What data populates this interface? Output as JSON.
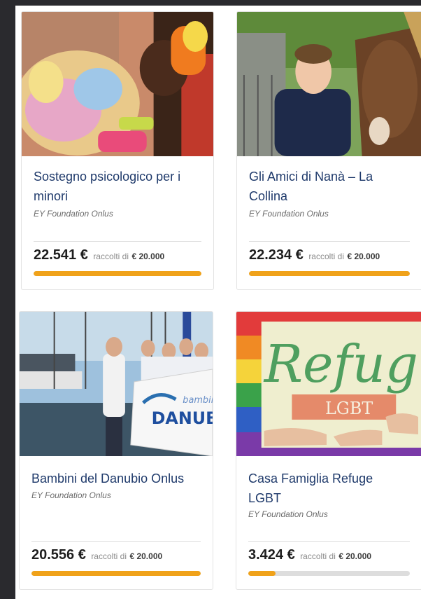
{
  "colors": {
    "accent": "#f0a21a",
    "title": "#1f3a6b",
    "track": "#dddddd"
  },
  "cards": [
    {
      "title": "Sostegno psicologico per i minori",
      "org": "EY Foundation Onlus",
      "amount": "22.541 €",
      "raised_label": "raccolti di",
      "goal": "€ 20.000",
      "progress": 1.0
    },
    {
      "title": "Gli Amici di Nanà – La Collina",
      "org": "EY Foundation Onlus",
      "amount": "22.234 €",
      "raised_label": "raccolti di",
      "goal": "€ 20.000",
      "progress": 1.0
    },
    {
      "title": "Bambini del Danubio Onlus",
      "org": "EY Foundation Onlus",
      "amount": "20.556 €",
      "raised_label": "raccolti di",
      "goal": "€ 20.000",
      "progress": 1.0
    },
    {
      "title": "Casa Famiglia Refuge LGBT",
      "org": "EY Foundation Onlus",
      "amount": "3.424 €",
      "raised_label": "raccolti di",
      "goal": "€ 20.000",
      "progress": 0.17
    }
  ],
  "photo_text": {
    "banner_top": "bambini",
    "banner_main": "DANUBI",
    "refuge_word": "Refug",
    "refuge_tag": "LGBT"
  }
}
